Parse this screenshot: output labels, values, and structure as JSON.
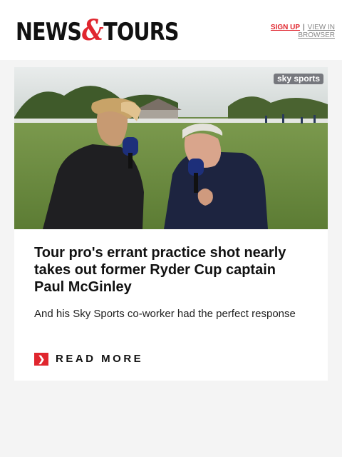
{
  "header": {
    "logo_left": "NEWS",
    "logo_amp": "&",
    "logo_right": "TOURS",
    "signup_label": "SIGN UP",
    "separator": "|",
    "view_in_browser_label": "VIEW IN BROWSER"
  },
  "article": {
    "image_watermark": "sky sports",
    "headline": "Tour pro's errant practice shot nearly takes out former Ryder Cup captain Paul McGinley",
    "summary": "And his Sky Sports co-worker had the perfect response",
    "read_more_label": "READ MORE",
    "read_more_icon": "chevron-right-icon"
  },
  "colors": {
    "accent": "#e0262e",
    "page_background": "#f4f4f4",
    "card_background": "#ffffff"
  }
}
